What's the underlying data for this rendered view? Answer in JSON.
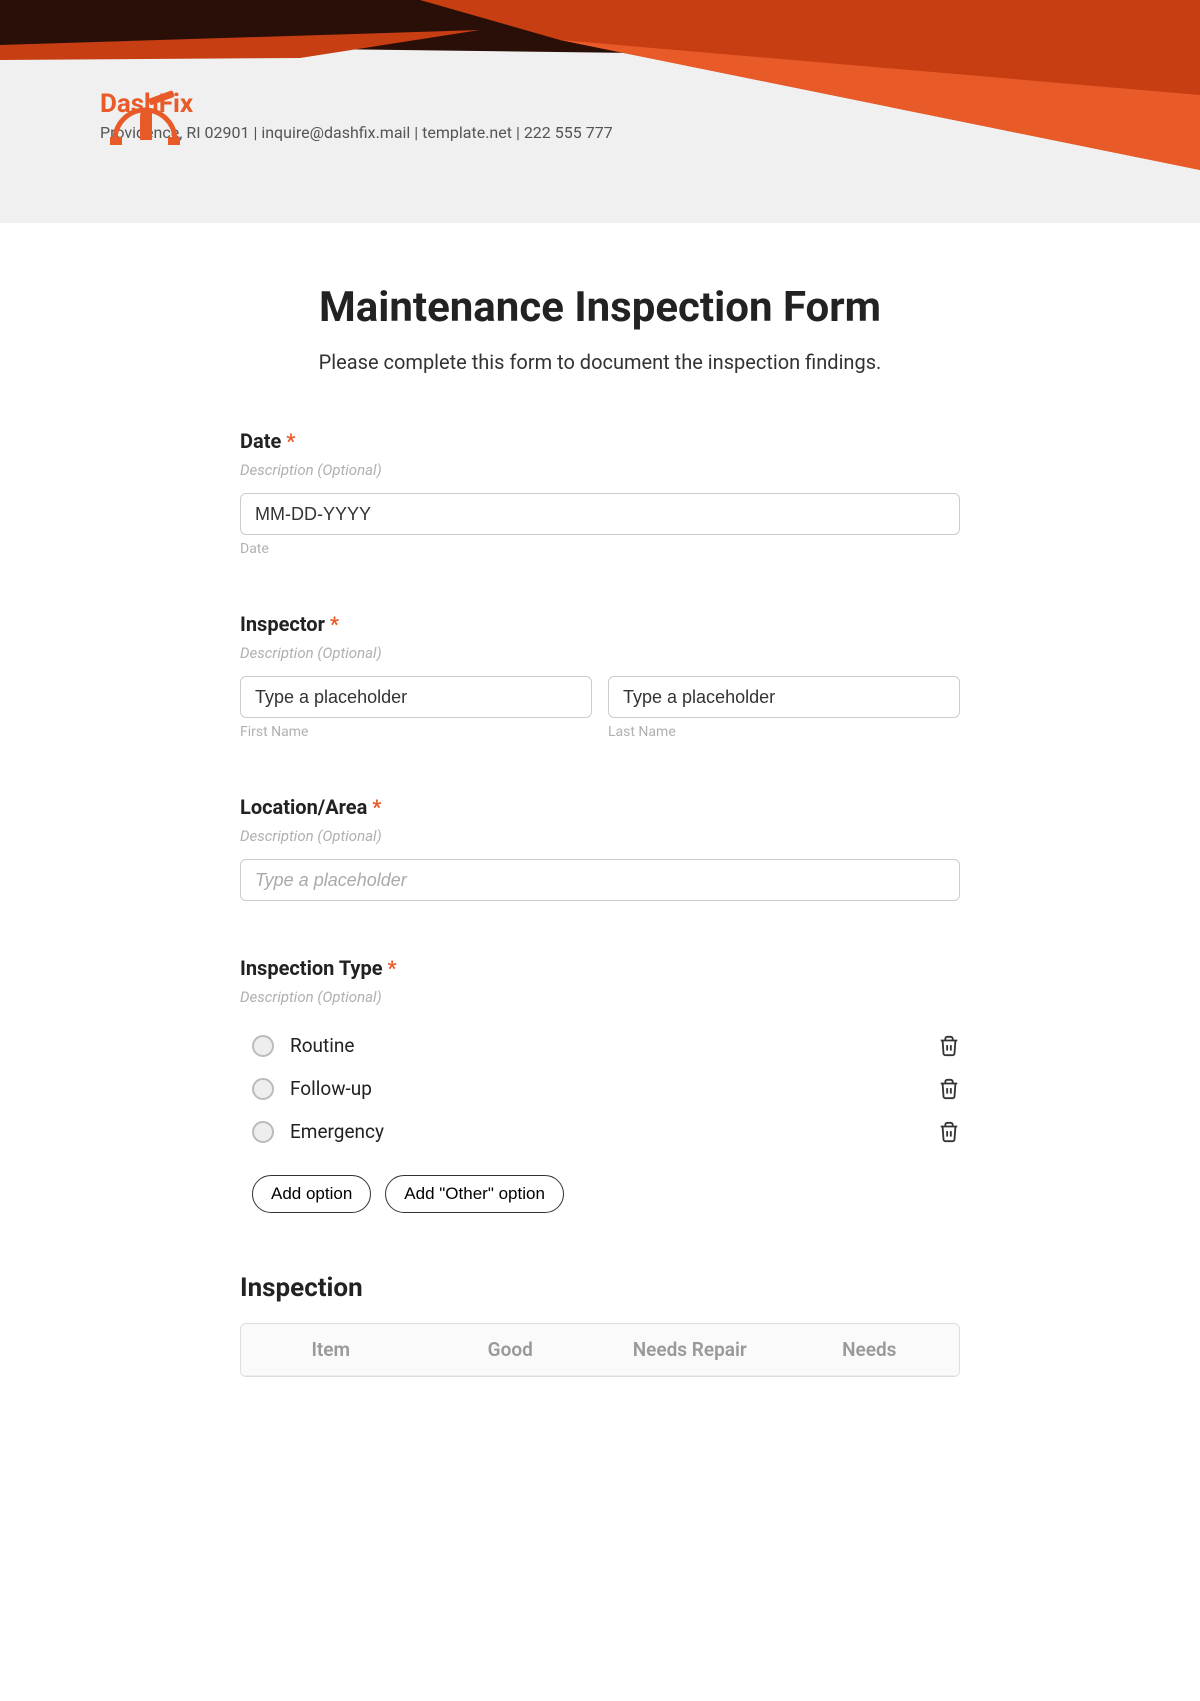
{
  "brand": {
    "name": "DashFix",
    "contact": "Providence, RI 02901 | inquire@dashfix.mail | template.net | 222 555 777"
  },
  "form": {
    "title": "Maintenance Inspection Form",
    "subtitle": "Please complete this form to document the inspection findings."
  },
  "fields": {
    "date": {
      "label": "Date",
      "desc": "Description (Optional)",
      "placeholder": "MM-DD-YYYY",
      "sub": "Date"
    },
    "inspector": {
      "label": "Inspector",
      "desc": "Description (Optional)",
      "first_placeholder": "Type a placeholder",
      "last_placeholder": "Type a placeholder",
      "first_sub": "First Name",
      "last_sub": "Last Name"
    },
    "location": {
      "label": "Location/Area",
      "desc": "Description (Optional)",
      "placeholder": "Type a placeholder"
    },
    "type": {
      "label": "Inspection Type",
      "desc": "Description (Optional)",
      "options": [
        "Routine",
        "Follow-up",
        "Emergency"
      ],
      "add_option": "Add option",
      "add_other": "Add \"Other\" option"
    }
  },
  "inspection": {
    "heading": "Inspection",
    "columns": [
      "Item",
      "Good",
      "Needs Repair",
      "Needs"
    ]
  }
}
